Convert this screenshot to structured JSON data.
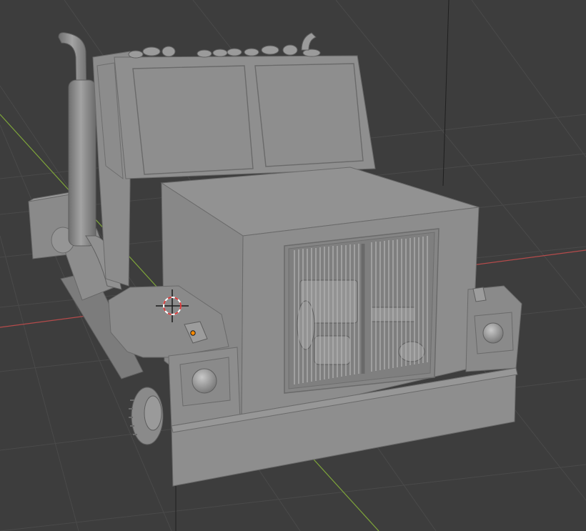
{
  "viewport": {
    "kind": "3d-viewport",
    "background_color": "#3d3d3d",
    "grid_color": "#4a4a4a",
    "x_axis_color": "#b54b4b",
    "y_axis_color": "#7ea53a",
    "z_axis_color": "#1f1f1f",
    "model": {
      "name": "truck-cab",
      "shading": "solid",
      "base_color": "#8b8b8b"
    },
    "cursor_icon": "3d-cursor-icon",
    "origin_icon": "object-origin-icon",
    "origin_color": "#ff8a00"
  }
}
